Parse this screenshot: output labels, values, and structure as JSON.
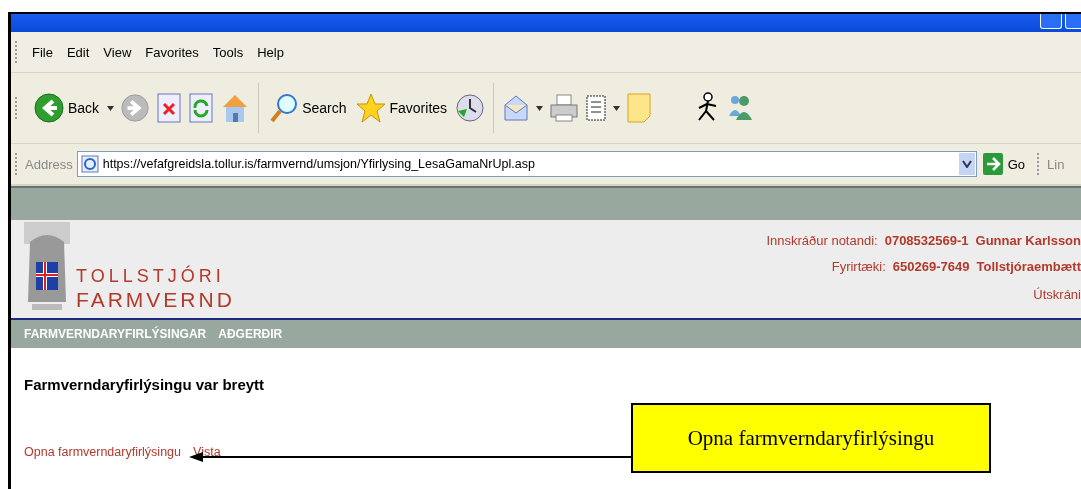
{
  "menu": [
    "File",
    "Edit",
    "View",
    "Favorites",
    "Tools",
    "Help"
  ],
  "toolbar": {
    "back": "Back",
    "search": "Search",
    "favorites": "Favorites"
  },
  "address": {
    "label": "Address",
    "url": "https://vefafgreidsla.tollur.is/farmvernd/umsjon/Yfirlysing_LesaGamaNrUpl.asp",
    "go": "Go",
    "links": "Lin"
  },
  "header": {
    "brand": [
      "TOLLSTJÓRI",
      "FARMVERND"
    ],
    "info": [
      {
        "label": "Innskráður notandi:",
        "id": "0708532569-1",
        "name": "Gunnar Karlsson"
      },
      {
        "label": "Fyrirtæki:",
        "id": "650269-7649",
        "name": "Tollstjóraembætt"
      }
    ],
    "logout": "Útskráni"
  },
  "nav": [
    "FARMVERNDARYFIRLÝSINGAR",
    "AÐGERÐIR"
  ],
  "content": {
    "heading": "Farmverndaryfirlýsingu var breytt",
    "links": [
      "Opna farmverndaryfirlýsingu",
      "Vista"
    ]
  },
  "callout": {
    "text": "Opna farmverndaryfirlýsingu"
  }
}
